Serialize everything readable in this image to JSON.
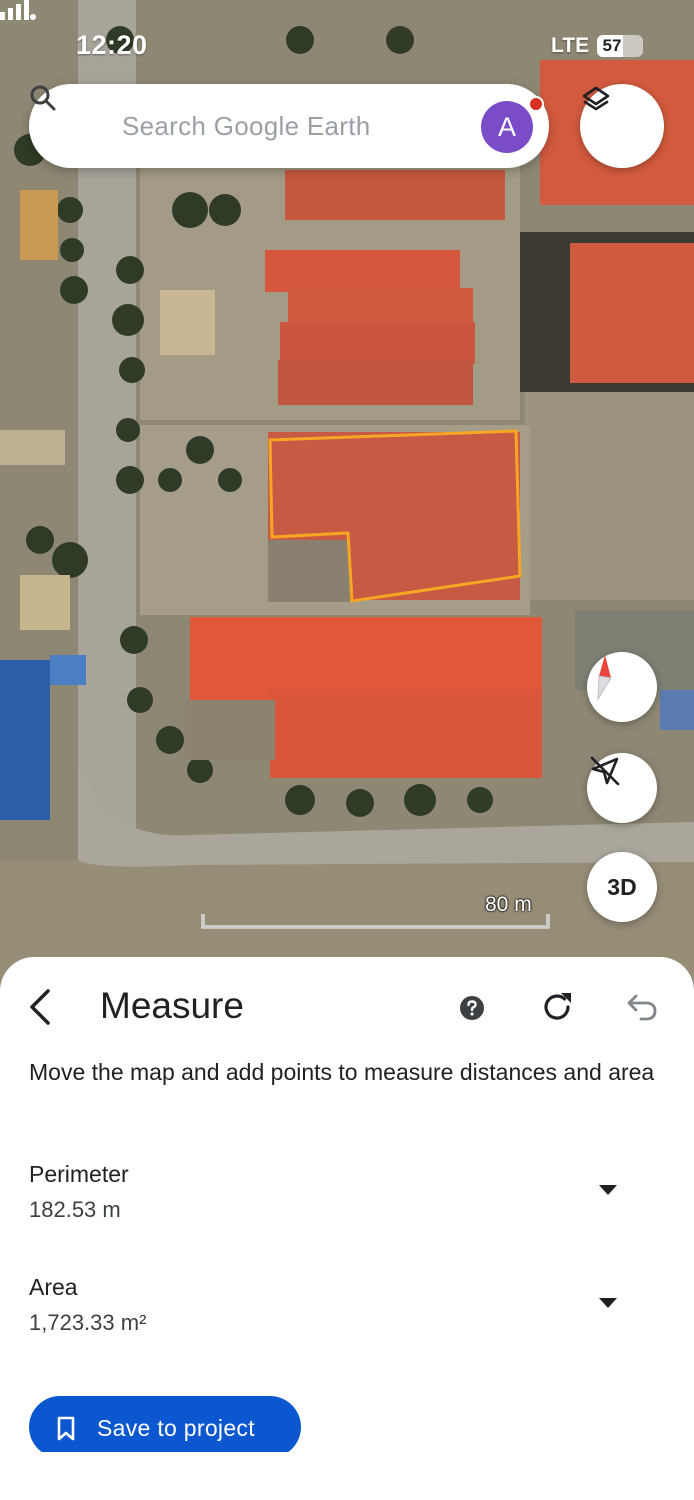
{
  "status_bar": {
    "time": "12:20",
    "network": "LTE",
    "battery": "57",
    "battery_level": 0.57
  },
  "search": {
    "placeholder": "Search Google Earth",
    "avatar_letter": "A",
    "icon": "search-icon"
  },
  "map": {
    "scale_label": "80 m",
    "measure_outline_color": "#f5a623",
    "buttons": {
      "layers": "layers-icon",
      "compass": "compass-icon",
      "tilt": "tilt-off-icon",
      "threed": "3D"
    }
  },
  "measure": {
    "title": "Measure",
    "instructions": "Move the map and add points to measure distances and area",
    "perimeter_label": "Perimeter",
    "perimeter_value": "182.53 m",
    "area_label": "Area",
    "area_value": "1,723.33 m²",
    "save_label": "Save to project",
    "accent_color": "#0b57d0"
  }
}
